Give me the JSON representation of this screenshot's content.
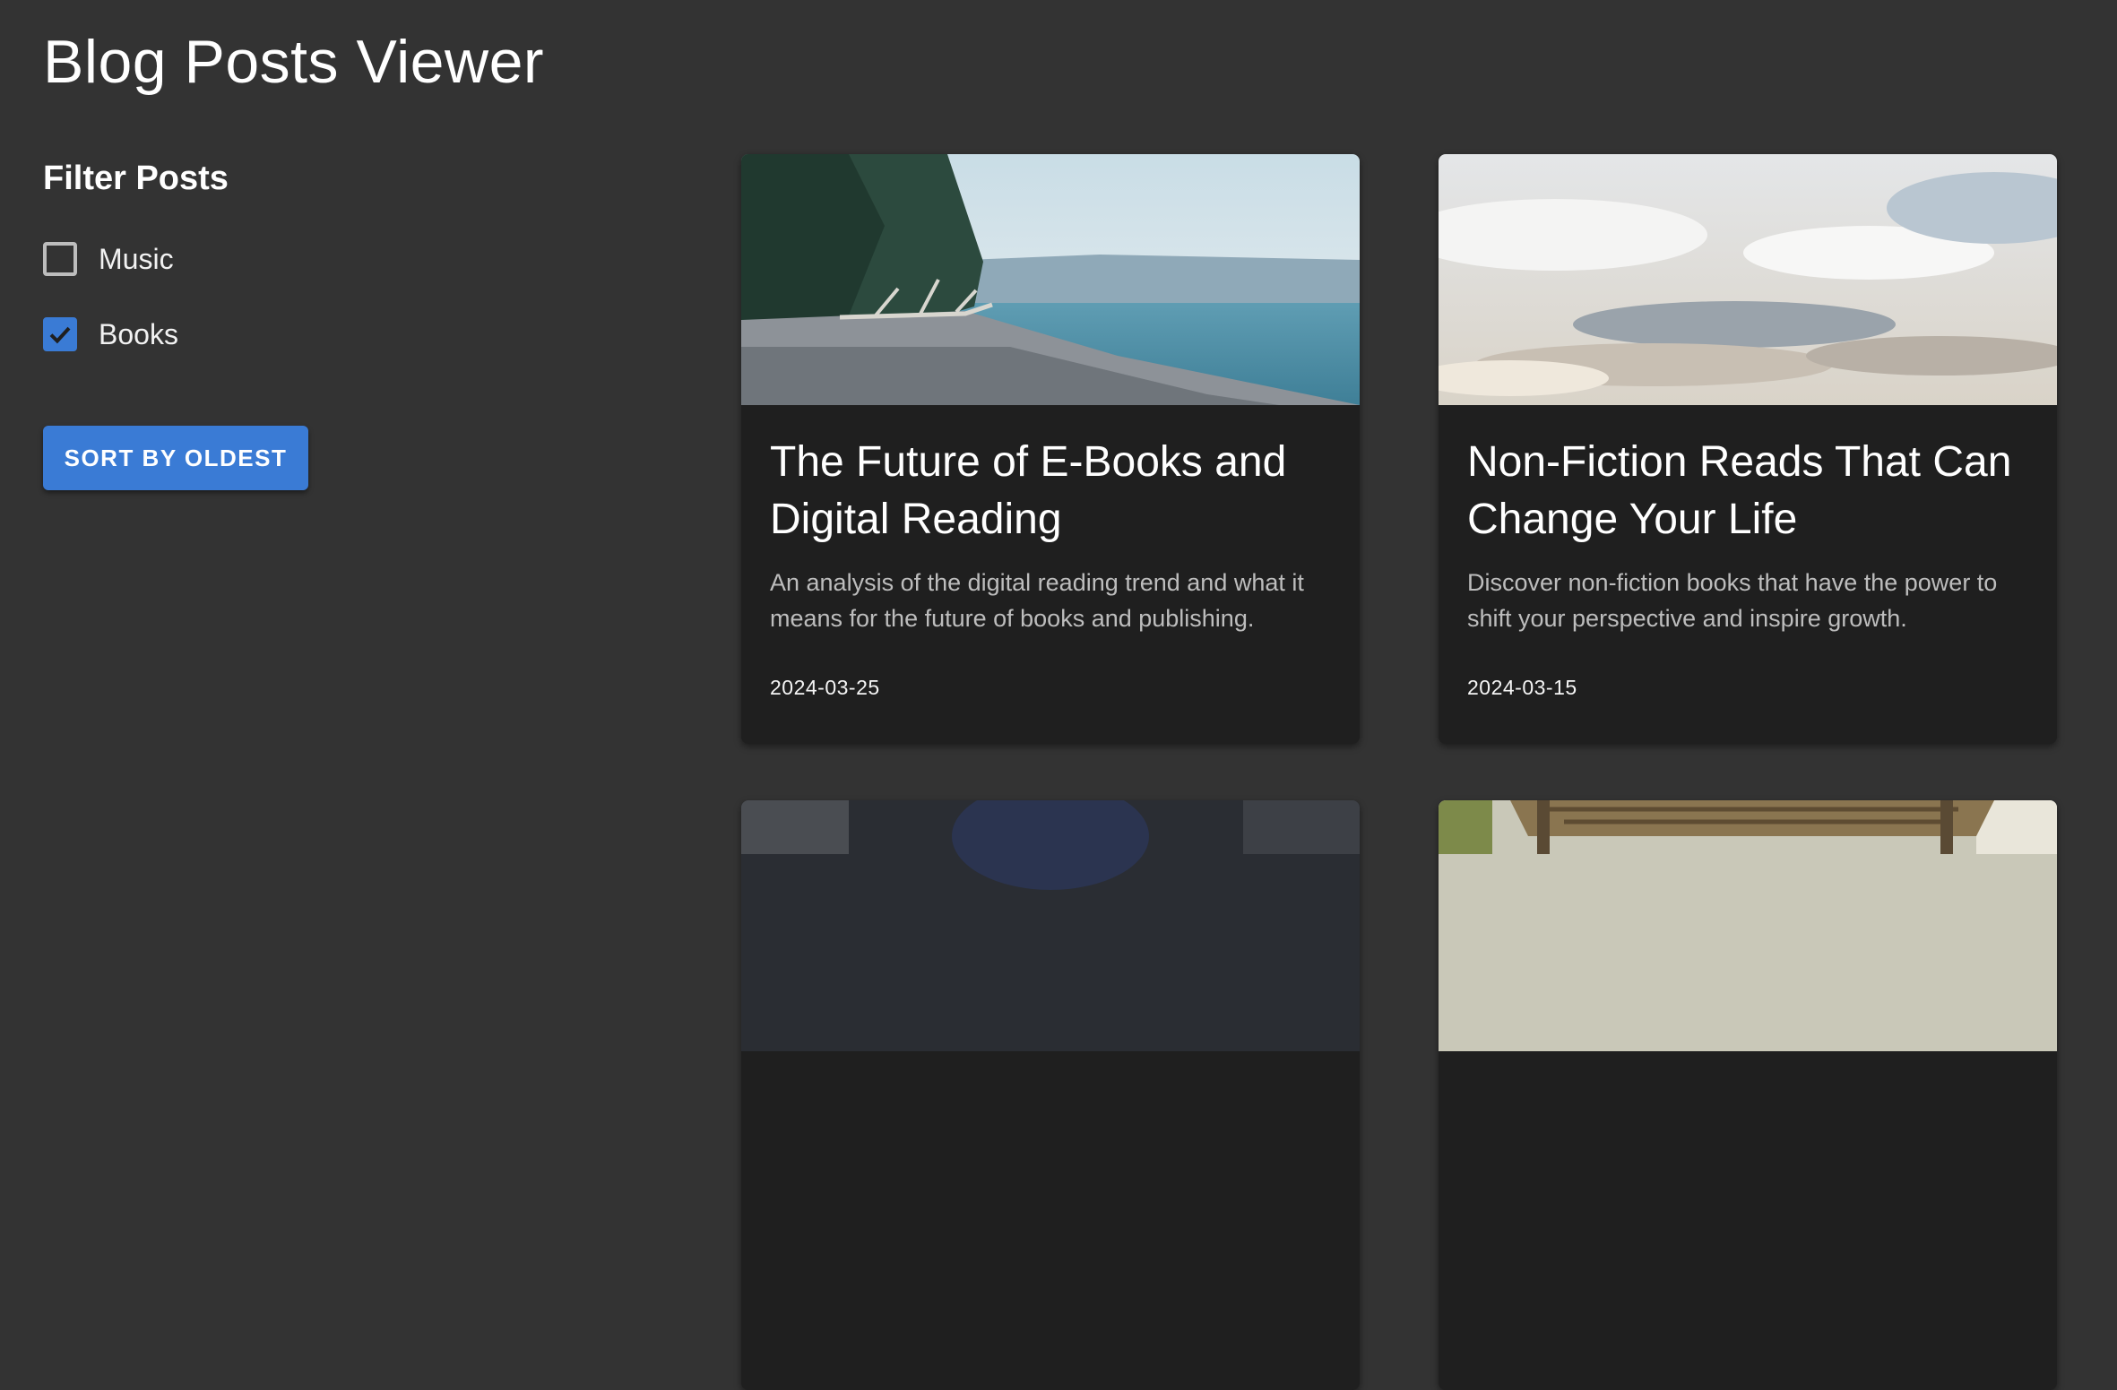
{
  "header": {
    "title": "Blog Posts Viewer"
  },
  "filters": {
    "title": "Filter Posts",
    "options": [
      {
        "label": "Music",
        "checked": false
      },
      {
        "label": "Books",
        "checked": true
      }
    ]
  },
  "sort_button": {
    "label": "SORT BY OLDEST"
  },
  "posts": [
    {
      "title": "The Future of E-Books and Digital Reading",
      "description": "An analysis of the digital reading trend and what it means for the future of books and publishing.",
      "date": "2024-03-25",
      "image": "beach-shoreline-photo"
    },
    {
      "title": "Non-Fiction Reads That Can Change Your Life",
      "description": "Discover non-fiction books that have the power to shift your perspective and inspire growth.",
      "date": "2024-03-15",
      "image": "cloudy-sky-photo"
    },
    {
      "image": "dark-portrait-photo"
    },
    {
      "image": "wooden-bridge-photo"
    }
  ],
  "colors": {
    "background": "#333333",
    "card": "#1f1f1f",
    "accent": "#3a7bd5"
  }
}
